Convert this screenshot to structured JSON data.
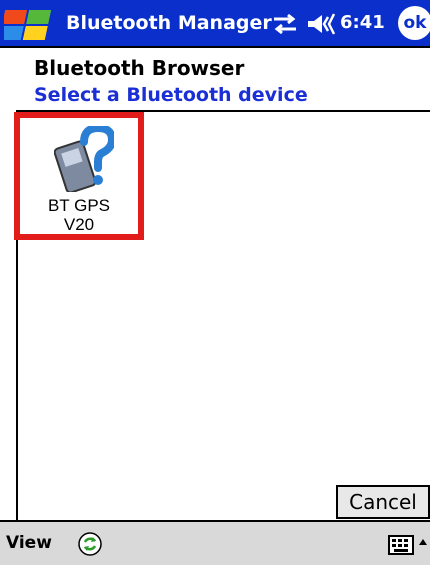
{
  "titlebar": {
    "title": "Bluetooth Manager",
    "clock": "6:41",
    "ok_label": "ok",
    "color": "#0a2fcb"
  },
  "header": {
    "heading": "Bluetooth Browser",
    "subheading": "Select a Bluetooth device",
    "subheading_color": "#1a2fd6"
  },
  "devices": [
    {
      "label": "BT GPS\nV20",
      "icon": "unknown-device-icon",
      "selected": true,
      "highlight_color": "#e21b1b"
    }
  ],
  "buttons": {
    "cancel_label": "Cancel"
  },
  "menubar": {
    "view_label": "View",
    "refresh_icon": "refresh-icon",
    "keyboard_icon": "keyboard-icon"
  }
}
